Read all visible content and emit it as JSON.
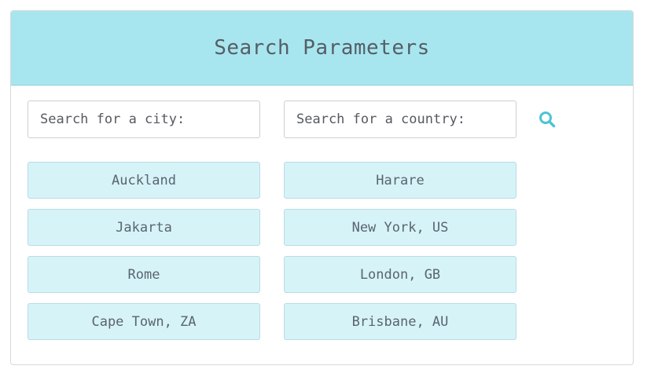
{
  "header": {
    "title": "Search Parameters"
  },
  "search": {
    "city_placeholder": "Search for a city:",
    "country_placeholder": "Search for a country:",
    "search_icon": "search-icon",
    "accent_color": "#4dc4d4"
  },
  "cities": {
    "left": [
      "Auckland",
      "Jakarta",
      "Rome",
      "Cape Town, ZA"
    ],
    "right": [
      "Harare",
      "New York, US",
      "London, GB",
      "Brisbane, AU"
    ]
  },
  "colors": {
    "header_bg": "#a8e6ef",
    "button_bg": "#d6f3f8"
  }
}
